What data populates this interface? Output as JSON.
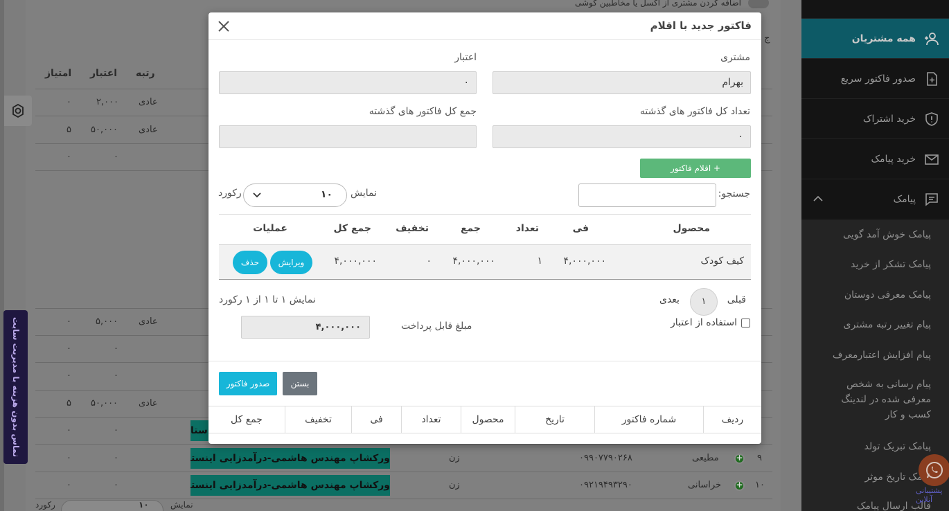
{
  "background": {
    "toggle_text": "اضافه کردن مشتری از اکسل یا مخاطبین گوشی",
    "side_char": "ج",
    "headers": [
      "رتبه",
      "اعتبار",
      "امتیاز"
    ],
    "rows": [
      {
        "rank": "عادی",
        "credit": "۲,۰۰۰",
        "score": "۰"
      },
      {
        "rank": "عادی",
        "credit": "۵۰,۰۰۰",
        "score": "۵"
      },
      {
        "rank": "",
        "credit": "۰",
        "score": "۰"
      },
      {
        "rank": "عادی",
        "credit": "۵,۰۰۰",
        "score": "۰"
      },
      {
        "rank": "",
        "credit": "۰",
        "score": "۰"
      },
      {
        "rank": "",
        "credit": "۰",
        "score": "۰"
      },
      {
        "rank": "عادی",
        "credit": "۵۰,۰۰۰",
        "score": "۵"
      },
      {
        "rank": "",
        "credit": "۰",
        "score": "۰"
      },
      {
        "rank": "",
        "credit": "۰",
        "score": "۰"
      },
      {
        "rank": "",
        "credit": "۰",
        "score": "۰"
      }
    ],
    "banner_top": "ستا",
    "banner_text": "ورکشاپ مهندس هاشمی-درآمدزایی اینستا",
    "customers": [
      {
        "num": "۹",
        "name": "مطیعی",
        "phone": "۰۹۹۰۷۷۹۰۲۶۸",
        "gender": "زن"
      },
      {
        "num": "۱۰",
        "name": "خراسانی",
        "phone": "۰۹۲۱۹۴۹۳۲۹۰",
        "gender": "زن"
      }
    ],
    "vertical_tab": "تماس بدون هزینه با مدیریت سایت",
    "bottom_show": "نمایش",
    "bottom_records": "رکورد",
    "bottom_value": "۱۰"
  },
  "sidebar": {
    "items": [
      {
        "label": "همه مشتریان",
        "icon": "users-add-icon",
        "active": true
      },
      {
        "label": "صدور فاکتور سریع",
        "icon": "invoice-add-icon",
        "active": false
      },
      {
        "label": "خرید اشتراک",
        "icon": "shield-alert-icon",
        "active": false
      },
      {
        "label": "خرید پیامک",
        "icon": "envelope-icon",
        "active": false
      },
      {
        "label": "پیامک",
        "icon": "message-icon",
        "active": false
      }
    ],
    "sub_items": [
      "پیامک خوش آمد گویی",
      "پیامک تشکر از خرید",
      "پیامک معرفی دوستان",
      "پیام تغییر رتبه مشتری",
      "پیام افزایش اعتبارمعرف",
      "پیام رسانی به شخص معرفی شده در لندینگ کسب و کار",
      "پیامک تبریک تولد",
      "پیامک تاریخ موثر",
      "قالب ارسال پیامک"
    ],
    "whatsapp_text": "پشتیبانی آنلاین"
  },
  "modal": {
    "title": "فاکتور جدید با اقلام",
    "customer_label": "مشتری",
    "customer_value": "بهرام",
    "credit_label": "اعتبار",
    "credit_value": "۰",
    "invoice_count_label": "تعداد کل فاکتور های گذشته",
    "invoice_count_value": "۰",
    "invoice_total_label": "جمع کل فاکتور های گذشته",
    "invoice_total_value": "",
    "add_items_button": "+ اقلام فاکتور",
    "search_label": "جستجو:",
    "show_label": "نمایش",
    "page_size": "۱۰",
    "records_label": "رکورد",
    "columns": {
      "product": "محصول",
      "price": "فی",
      "quantity": "تعداد",
      "sum": "جمع",
      "discount": "تخفیف",
      "total": "جمع کل",
      "actions": "عملیات"
    },
    "row": {
      "product": "کیف کودک",
      "price": "۴,۰۰۰,۰۰۰",
      "quantity": "۱",
      "sum": "۴,۰۰۰,۰۰۰",
      "discount": "۰",
      "total": "۴,۰۰۰,۰۰۰",
      "edit": "ویرایش",
      "delete": "حذف"
    },
    "prev": "قبلی",
    "page": "۱",
    "next": "بعدی",
    "showing": "نمایش ۱ تا ۱ از ۱ رکورد",
    "use_credit": "استفاده از اعتبار",
    "payable_label": "مبلغ قابل پرداخت",
    "payable_value": "۴,۰۰۰,۰۰۰",
    "issue_button": "صدور فاکتور",
    "close_button": "بستن",
    "bottom_columns": [
      "ردیف",
      "شماره فاکتور",
      "تاریخ",
      "محصول",
      "تعداد",
      "فی",
      "تخفیف",
      "جمع کل"
    ]
  },
  "colors": {
    "primary": "#17b6d9",
    "success": "#5cb87a",
    "secondary": "#6c757d",
    "sidebar_active": "#0d5a66"
  }
}
